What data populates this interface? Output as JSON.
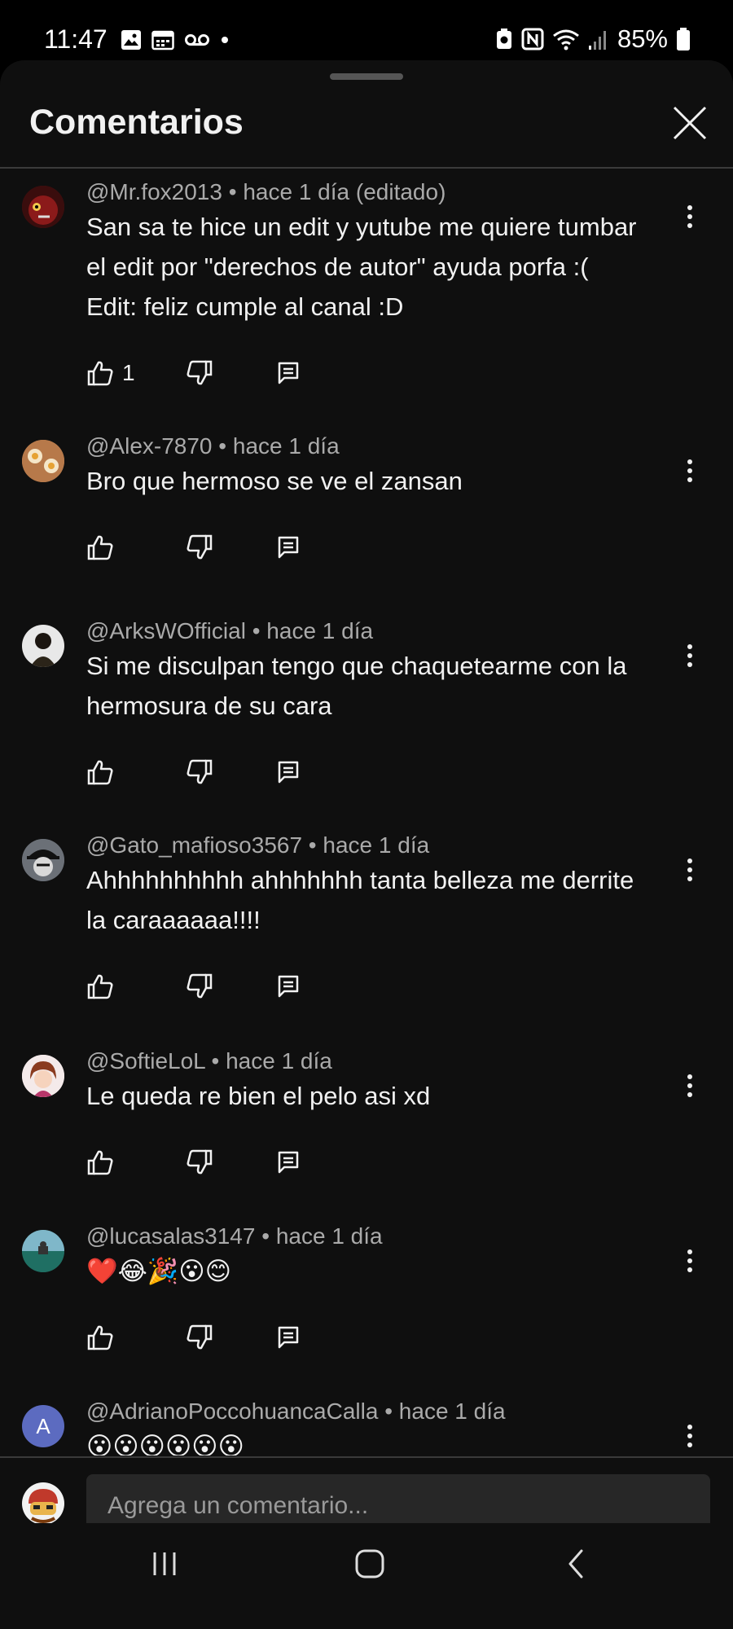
{
  "status_bar": {
    "time": "11:47",
    "battery": "85%",
    "left_icons": [
      "gallery-icon",
      "calendar-icon",
      "voicemail-icon",
      "dot-icon"
    ],
    "right_icons": [
      "battery-saver-icon",
      "nfc-icon",
      "wifi-icon",
      "signal-icon",
      "battery-icon"
    ]
  },
  "panel": {
    "title": "Comentarios",
    "close_icon": "close-icon"
  },
  "comments": [
    {
      "author": "@Mr.fox2013",
      "time": "hace 1 día (editado)",
      "lines": [
        "San sa te hice un edit y yutube me quiere tumbar",
        "el edit por \"derechos de autor\" ayuda porfa :(",
        "Edit: feliz cumple al canal :D"
      ],
      "likes": "1",
      "avatar_color": "#5a1414"
    },
    {
      "author": "@Alex-7870",
      "time": "hace 1 día",
      "lines": [
        "Bro que hermoso se ve el zansan"
      ],
      "likes": "",
      "avatar_color": "#c68a55"
    },
    {
      "author": "@ArksWOfficial",
      "time": "hace 1 día",
      "lines": [
        "Si me disculpan tengo que chaquetearme con la",
        "hermosura de su cara"
      ],
      "likes": "",
      "avatar_color": "#2b2419"
    },
    {
      "author": "@Gato_mafioso3567",
      "time": "hace 1 día",
      "lines": [
        "Ahhhhhhhhhh ahhhhhhh tanta belleza me derrite",
        "la caraaaaaa!!!!"
      ],
      "likes": "",
      "avatar_color": "#444a52"
    },
    {
      "author": "@SoftieLoL",
      "time": "hace 1 día",
      "lines": [
        "Le queda re bien el pelo asi xd"
      ],
      "likes": "",
      "avatar_color": "#e8d8d8"
    },
    {
      "author": "@lucasalas3147",
      "time": "hace 1 día",
      "lines": [
        "❤️😂🎉😮😊"
      ],
      "likes": "",
      "avatar_color": "#2f6f6a"
    },
    {
      "author": "@AdrianoPoccohuancaCalla",
      "time": "hace 1 día",
      "lines": [
        "😮😮😮😮😮😮"
      ],
      "likes": "",
      "avatar_color": "#5c6bc0",
      "avatar_letter": "A"
    }
  ],
  "composer": {
    "placeholder": "Agrega un comentario..."
  },
  "nav": {
    "icons": [
      "recent-apps-icon",
      "home-icon",
      "back-icon"
    ]
  }
}
